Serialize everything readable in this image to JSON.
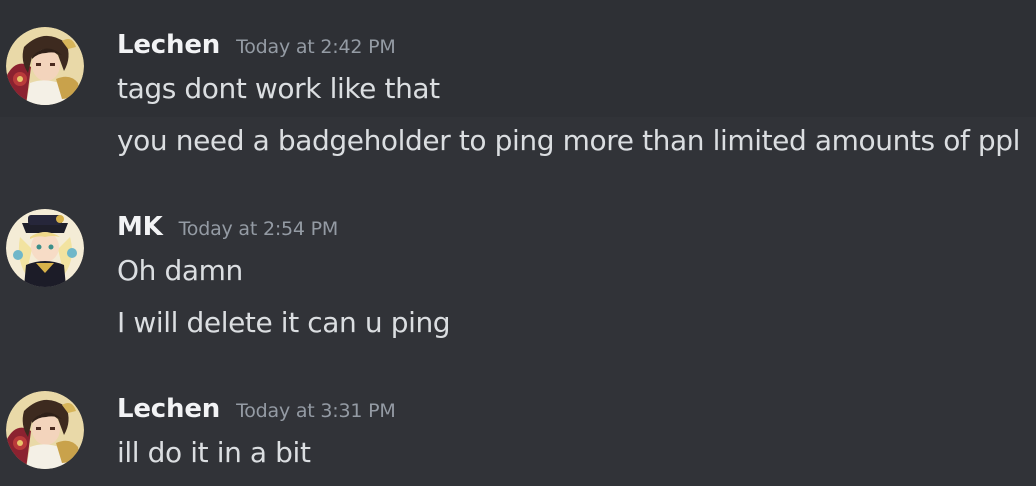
{
  "messages": [
    {
      "author": "Lechen",
      "timestamp": "Today at 2:42 PM",
      "avatar_icon": "anime-character-avatar-lechen",
      "lines": [
        "tags dont work like that",
        "you need a badgeholder to ping more than limited amounts of ppl"
      ]
    },
    {
      "author": "MK",
      "timestamp": "Today at 2:54 PM",
      "avatar_icon": "anime-character-avatar-mk",
      "lines": [
        "Oh damn",
        "I will delete it can u ping"
      ]
    },
    {
      "author": "Lechen",
      "timestamp": "Today at 3:31 PM",
      "avatar_icon": "anime-character-avatar-lechen",
      "lines": [
        "ill do it in a bit"
      ]
    }
  ],
  "colors": {
    "background": "#313338",
    "hover_background": "#2e3035",
    "username": "#f2f3f5",
    "timestamp": "#949ba4",
    "message_text": "#dbdee1"
  }
}
